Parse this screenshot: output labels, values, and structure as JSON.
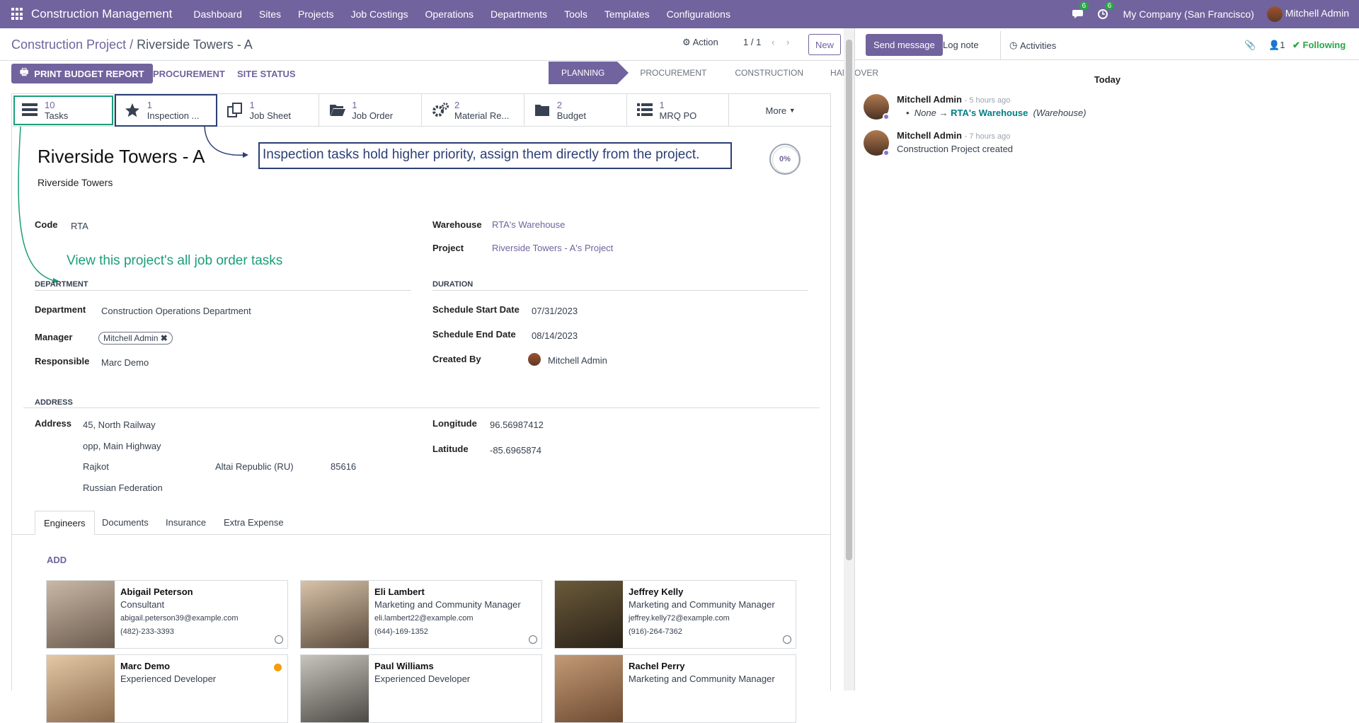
{
  "navbar": {
    "brand": "Construction Management",
    "menu": [
      "Dashboard",
      "Sites",
      "Projects",
      "Job Costings",
      "Operations",
      "Departments",
      "Tools",
      "Templates",
      "Configurations"
    ],
    "messages_count": "6",
    "activities_count": "6",
    "company": "My Company (San Francisco)",
    "user": "Mitchell Admin"
  },
  "control": {
    "breadcrumb_parent": "Construction Project",
    "breadcrumb_current": "Riverside Towers - A",
    "action_label": "Action",
    "pager": "1 / 1",
    "new_label": "New"
  },
  "toolbar": {
    "print_label": "PRINT BUDGET REPORT",
    "procurement_label": "PROCUREMENT",
    "site_status_label": "SITE STATUS"
  },
  "stages": [
    "PLANNING",
    "PROCUREMENT",
    "CONSTRUCTION",
    "HANDOVER"
  ],
  "smart_buttons": [
    {
      "count": "10",
      "label": "Tasks",
      "icon": "tasks-icon"
    },
    {
      "count": "1",
      "label": "Inspection ...",
      "icon": "star-icon"
    },
    {
      "count": "1",
      "label": "Job Sheet",
      "icon": "copy-icon"
    },
    {
      "count": "1",
      "label": "Job Order",
      "icon": "folder-open-icon"
    },
    {
      "count": "2",
      "label": "Material Re...",
      "icon": "gears-icon"
    },
    {
      "count": "2",
      "label": "Budget",
      "icon": "folder-icon"
    },
    {
      "count": "1",
      "label": "MRQ PO",
      "icon": "list-icon"
    }
  ],
  "more_label": "More",
  "form": {
    "title": "Riverside Towers - A",
    "subtitle": "Riverside Towers",
    "progress": "0%",
    "code_label": "Code",
    "code": "RTA",
    "warehouse_label": "Warehouse",
    "warehouse": "RTA's Warehouse",
    "project_label": "Project",
    "project": "Riverside Towers - A's Project",
    "department_section": "DEPARTMENT",
    "department_label": "Department",
    "department": "Construction Operations Department",
    "manager_label": "Manager",
    "manager": "Mitchell Admin",
    "responsible_label": "Responsible",
    "responsible": "Marc Demo",
    "duration_section": "DURATION",
    "start_label": "Schedule Start Date",
    "start": "07/31/2023",
    "end_label": "Schedule End Date",
    "end": "08/14/2023",
    "created_label": "Created By",
    "created": "Mitchell Admin",
    "address_section": "ADDRESS",
    "address_label": "Address",
    "street1": "45, North Railway",
    "street2": "opp, Main Highway",
    "city": "Rajkot",
    "state": "Altai Republic (RU)",
    "zip": "85616",
    "country": "Russian Federation",
    "longitude_label": "Longitude",
    "longitude": "96.56987412",
    "latitude_label": "Latitude",
    "latitude": "-85.6965874"
  },
  "annotations": {
    "inspection": "Inspection tasks hold higher priority, assign them directly from the project.",
    "tasks": "View this project's  all job order tasks"
  },
  "notebook": {
    "tabs": [
      "Engineers",
      "Documents",
      "Insurance",
      "Extra Expense"
    ],
    "add_label": "ADD",
    "engineers": [
      {
        "name": "Abigail Peterson",
        "job": "Consultant",
        "email": "abigail.peterson39@example.com",
        "phone": "(482)-233-3393"
      },
      {
        "name": "Eli Lambert",
        "job": "Marketing and Community Manager",
        "email": "eli.lambert22@example.com",
        "phone": "(644)-169-1352"
      },
      {
        "name": "Jeffrey Kelly",
        "job": "Marketing and Community Manager",
        "email": "jeffrey.kelly72@example.com",
        "phone": "(916)-264-7362"
      },
      {
        "name": "Marc Demo",
        "job": "Experienced Developer",
        "email": "",
        "phone": ""
      },
      {
        "name": "Paul Williams",
        "job": "Experienced Developer",
        "email": "",
        "phone": ""
      },
      {
        "name": "Rachel Perry",
        "job": "Marketing and Community Manager",
        "email": "",
        "phone": ""
      }
    ]
  },
  "chatter": {
    "send_message": "Send message",
    "log_note": "Log note",
    "activities": "Activities",
    "followers_count": "1",
    "following": "Following",
    "today": "Today",
    "messages": [
      {
        "author": "Mitchell Admin",
        "ago": "- 5 hours ago",
        "old": "None",
        "arrow": "→",
        "new": "RTA's Warehouse",
        "field": "(Warehouse)"
      },
      {
        "author": "Mitchell Admin",
        "ago": "- 7 hours ago",
        "body": "Construction Project created"
      }
    ]
  },
  "colors": {
    "accent": "#71639e",
    "annotation_green": "#1a9e79",
    "annotation_navy": "#2c3e75"
  }
}
